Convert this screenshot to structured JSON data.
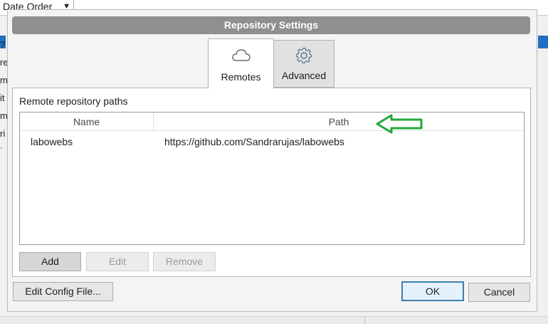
{
  "background": {
    "sort_combo_value": "Date Order",
    "left_fragments": [
      "?",
      "re",
      "m",
      "it",
      "m",
      "ri",
      "iv"
    ]
  },
  "dialog": {
    "title": "Repository Settings",
    "tabs": [
      {
        "label": "Remotes",
        "icon": "cloud-icon",
        "selected": true
      },
      {
        "label": "Advanced",
        "icon": "gear-icon",
        "selected": false
      }
    ],
    "remotes": {
      "section_label": "Remote repository paths",
      "columns": [
        "Name",
        "Path"
      ],
      "rows": [
        {
          "name": "labowebs",
          "path": "https://github.com/Sandrarujas/labowebs"
        }
      ],
      "buttons": {
        "add": "Add",
        "edit": "Edit",
        "remove": "Remove"
      }
    },
    "footer": {
      "edit_config": "Edit Config File...",
      "ok": "OK",
      "cancel": "Cancel"
    }
  },
  "colors": {
    "title_bar": "#8f8f8f",
    "annotation_arrow": "#22a83a",
    "default_button_border": "#3c7fb1"
  }
}
